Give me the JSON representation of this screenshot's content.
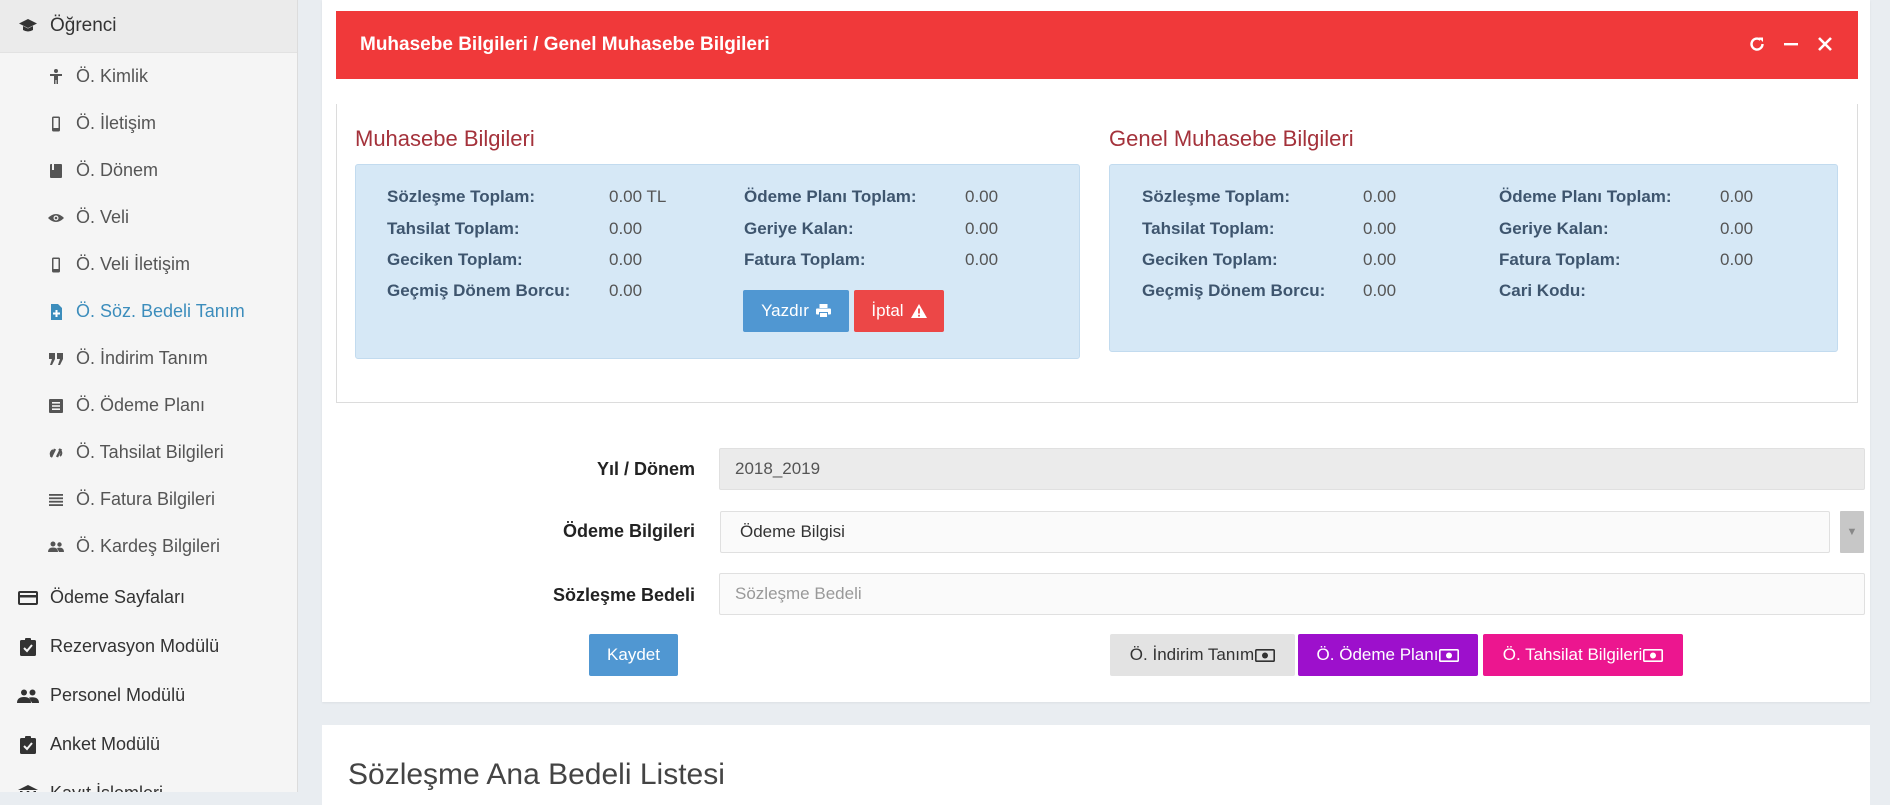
{
  "sidebar": {
    "top": {
      "label": "Öğrenci",
      "icon": "graduation-cap-icon"
    },
    "subitems": [
      {
        "label": "Ö. Kimlik",
        "icon": "person-icon"
      },
      {
        "label": "Ö. İletişim",
        "icon": "mobile-icon"
      },
      {
        "label": "Ö. Dönem",
        "icon": "book-icon"
      },
      {
        "label": "Ö. Veli",
        "icon": "eye-icon"
      },
      {
        "label": "Ö. Veli İletişim",
        "icon": "mobile-icon"
      },
      {
        "label": "Ö. Söz. Bedeli Tanım",
        "icon": "file-plus-icon",
        "active": true
      },
      {
        "label": "Ö. İndirim Tanım",
        "icon": "quote-icon"
      },
      {
        "label": "Ö. Ödeme Planı",
        "icon": "list-box-icon"
      },
      {
        "label": "Ö. Tahsilat Bilgileri",
        "icon": "link-icon"
      },
      {
        "label": "Ö. Fatura Bilgileri",
        "icon": "lines-icon"
      },
      {
        "label": "Ö. Kardeş Bilgileri",
        "icon": "people-icon"
      }
    ],
    "main": [
      {
        "label": "Ödeme Sayfaları",
        "icon": "credit-card-icon"
      },
      {
        "label": "Rezervasyon Modülü",
        "icon": "clipboard-icon"
      },
      {
        "label": "Personel Modülü",
        "icon": "people-icon"
      },
      {
        "label": "Anket Modülü",
        "icon": "clipboard-icon"
      },
      {
        "label": "Kayıt İşlemleri",
        "icon": "bank-icon"
      }
    ]
  },
  "header": {
    "title": "Muhasebe Bilgileri / Genel Muhasebe Bilgileri",
    "color": "#f0393a"
  },
  "left_panel": {
    "title": "Muhasebe Bilgileri",
    "col1": [
      {
        "label": "Sözleşme Toplam:",
        "value": "0.00 TL"
      },
      {
        "label": "Tahsilat Toplam:",
        "value": "0.00"
      },
      {
        "label": "Geciken Toplam:",
        "value": "0.00"
      },
      {
        "label": "Geçmiş Dönem Borcu:",
        "value": "0.00"
      }
    ],
    "col2": [
      {
        "label": "Ödeme Planı Toplam:",
        "value": "0.00"
      },
      {
        "label": "Geriye Kalan:",
        "value": "0.00"
      },
      {
        "label": "Fatura Toplam:",
        "value": "0.00"
      }
    ],
    "print_label": "Yazdır",
    "cancel_label": "İptal"
  },
  "right_panel": {
    "title": "Genel Muhasebe Bilgileri",
    "col1": [
      {
        "label": "Sözleşme Toplam:",
        "value": "0.00"
      },
      {
        "label": "Tahsilat Toplam:",
        "value": "0.00"
      },
      {
        "label": "Geciken Toplam:",
        "value": "0.00"
      },
      {
        "label": "Geçmiş Dönem Borcu:",
        "value": "0.00"
      }
    ],
    "col2": [
      {
        "label": "Ödeme Planı Toplam:",
        "value": "0.00"
      },
      {
        "label": "Geriye Kalan:",
        "value": "0.00"
      },
      {
        "label": "Fatura Toplam:",
        "value": "0.00"
      },
      {
        "label": "Cari Kodu:",
        "value": ""
      }
    ]
  },
  "form": {
    "year_label": "Yıl / Dönem",
    "year_value": "2018_2019",
    "payment_label": "Ödeme Bilgileri",
    "payment_value": "Ödeme Bilgisi",
    "contract_label": "Sözleşme Bedeli",
    "contract_placeholder": "Sözleşme Bedeli",
    "save_label": "Kaydet",
    "discount_btn": "Ö. İndirim Tanım",
    "payment_plan_btn": "Ö. Ödeme Planı",
    "collection_btn": "Ö. Tahsilat Bilgileri"
  },
  "list": {
    "title": "Sözleşme Ana Bedeli Listesi"
  }
}
